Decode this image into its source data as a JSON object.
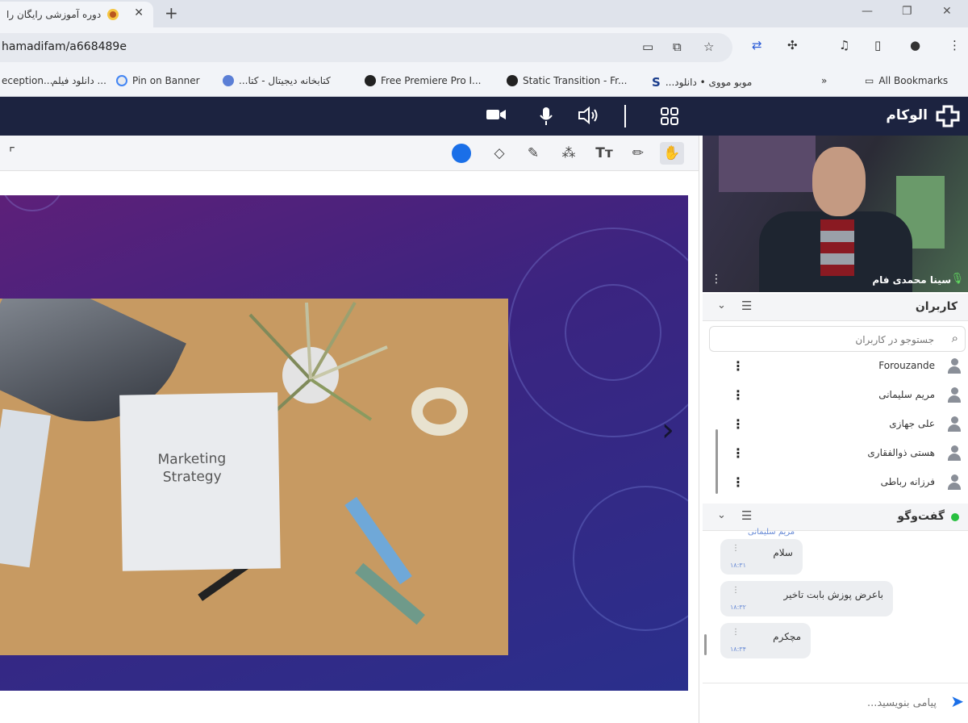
{
  "browser": {
    "tab_title": "دوره آموزشی رایگان را",
    "url": "hamadifam/a668489e",
    "bookmarks": [
      "eception...",
      "دانلود فیلم ...",
      "Pin on Banner",
      "کتابخانه دیجیتال - کتا...",
      "Free Premiere Pro I...",
      "Static Transition - Fr...",
      "موبو مووی • دانلود...",
      "All Bookmarks"
    ]
  },
  "app": {
    "logo_text": "الوکام"
  },
  "slide": {
    "note_text_line1": "Marketing",
    "note_text_line2": "Strategy"
  },
  "video": {
    "presenter_name": "سینا محمدی فام"
  },
  "users": {
    "title": "کاربران",
    "search_placeholder": "جستوجو در کاربران",
    "list": [
      "Forouzande",
      "مریم سلیمانی",
      "علی جهازی",
      "هستی ذوالفقاری",
      "فرزانه رباطی"
    ]
  },
  "chat": {
    "title": "گفت‌وگو",
    "sender": "مریم سلیمانی",
    "messages": [
      {
        "text": "سلام",
        "time": "۱۸:۳۱"
      },
      {
        "text": "باعرض پوزش بابت تاخیر",
        "time": "۱۸:۳۲"
      },
      {
        "text": "مچکرم",
        "time": "۱۸:۳۴"
      }
    ],
    "input_placeholder": "پیامی بنویسید..."
  },
  "colors": {
    "header_bg": "#1c2340",
    "accent": "#1a6fe8",
    "online": "#28c040"
  }
}
